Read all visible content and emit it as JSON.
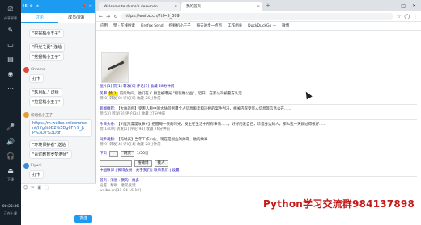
{
  "taskbar": {
    "items": [
      "分享屏幕",
      "",
      "",
      "",
      "",
      "",
      ""
    ],
    "labels": [
      "分享屏幕",
      "下课"
    ],
    "time": "00:25:36",
    "status": "正在上课"
  },
  "chat": {
    "header_icons": [
      "IE",
      "⚙",
      "★",
      "📌",
      "✕"
    ],
    "tabs": [
      "讨论",
      "成员(89)"
    ],
    "messages": [
      {
        "user": "",
        "text": "\"挖掘机小王子\""
      },
      {
        "user": "",
        "text": "\"阳光之夏\" 送给"
      },
      {
        "user": "",
        "text": "\"挖掘机小王子\""
      },
      {
        "user": "Chrome",
        "text": "打卡"
      },
      {
        "user": "",
        "text": "\"玖月乱.\" 送给"
      },
      {
        "user": "",
        "text": "\"挖掘机小王子\""
      },
      {
        "user": "新烟机小王子",
        "text": "https://m.weibo.cn/comment/hfg%5B2%5Dg6FFr9_JtP%3D7%3Ddf"
      },
      {
        "user": "",
        "text": "\"环境保护者\" 送给"
      },
      {
        "user": "",
        "text": "\"青灯教育罗梦老师\""
      },
      {
        "user": "Flyuni",
        "text": "打卡"
      }
    ],
    "send_label": "发送",
    "tools": [
      "☺",
      "✂",
      "▣",
      "⬚"
    ]
  },
  "browser": {
    "tabs": [
      {
        "title": "Welcome to demo's documen",
        "active": false
      },
      {
        "title": "我的首页",
        "active": true
      }
    ],
    "url": "https://weibo.cn/?tf=5_009",
    "bookmarks": [
      "应用",
      "赞  - 在线搜索",
      "Firefox Send",
      "挖掘机小王子",
      "每天进步一点点",
      "工作相关",
      "DuckDuckGo —",
      "微博"
    ],
    "links_row": "图片[1] 赞[1] 转发[0] 评论[1] 收藏  28分钟前",
    "post1": {
      "author": "美甲",
      "highlight": "赞[1]",
      "text": "前段时间，他们在 C 群里被曝光 \"假装做公益\"，近日，在家公司被警方认定......",
      "meta": "赞[0] 转发[0] 评论[0] 收藏  26分钟前"
    },
    "post2": {
      "author": "新闻推荐",
      "text": "【大陆首例】受害人称中国大陆首例遭个人信息贩卖和违规的案件判决，相关内容受害人信息等信息公开......",
      "meta": "赞[53] 转发[8] 评论[34] 收藏  27分钟前"
    },
    "post3": {
      "author": "今日头条",
      "text": "【#魔咒漫漫故事#】把握每一天的时光，发生在生活中所有事情......，好好的爱自己，珍惜身边的人，那么这一天就过得很好......",
      "meta": "赞[1400] 转发[1] 评论[94] 收藏  26分钟前"
    },
    "post4": {
      "author": "同步视频",
      "text": "【冯时光】当年工作小伙，现在是创业的帅哥，他的故事......",
      "meta": "赞[9] 转发[4] 评论[4] 收藏  28分钟前"
    },
    "pager": {
      "next": "下页",
      "page": "1/50页",
      "go": "跳页"
    },
    "footer_actions": [
      "搜微博",
      "找人"
    ],
    "footer_links": "中国微博 | 微博会员 | 关于我们 | 联系我们 | 设置",
    "bottom_links": "首页 · 消息 · 我的 · 更多",
    "footer_text": "设置 · 帮助 · 意见反馈",
    "footer_text2": "weibo.cn[11-04 15:19]"
  },
  "watermark": "Python学习交流群984137898"
}
